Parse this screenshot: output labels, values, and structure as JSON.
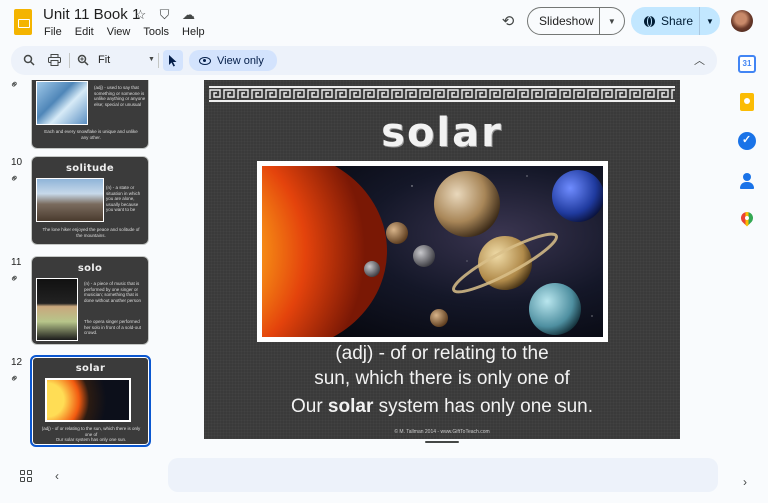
{
  "header": {
    "title": "Unit 11 Book 1",
    "menu": [
      "File",
      "Edit",
      "View",
      "Tools",
      "Help"
    ],
    "slideshow_label": "Slideshow",
    "share_label": "Share"
  },
  "toolbar": {
    "zoom": "Fit",
    "view_only_label": "View only"
  },
  "filmstrip": {
    "slides": [
      {
        "number": "",
        "title": "",
        "text": "(adj) - used to say that something or someone is unlike anything or anyone else; special or unusual",
        "caption": "Each and every snowflake is unique and unlike any other."
      },
      {
        "number": "10",
        "title": "solitude",
        "text": "(n) - a state or situation in which you are alone, usually because you want to be",
        "caption": "The lone hiker enjoyed the peace and solitude of the mountains."
      },
      {
        "number": "11",
        "title": "solo",
        "text": "(n) - a piece of music that is performed by one singer or musician; something that is done without another person",
        "caption": "The opera singer performed her solo in front of a sold-out crowd."
      },
      {
        "number": "12",
        "title": "solar",
        "text": "(adj) - of or relating to the sun, which there is only one of",
        "caption": "Our solar system has only one sun."
      }
    ]
  },
  "slide": {
    "title": "solar",
    "definition_line1": "(adj) - of or relating to the",
    "definition_line2": "sun, which there is only one of",
    "example_before": "Our ",
    "example_bold": "solar",
    "example_after": " system has only one sun.",
    "credit": "© M. Tallman 2014 - www.GiftToTeach.com"
  },
  "side_panel": {
    "icons": [
      "calendar-icon",
      "keep-icon",
      "tasks-icon",
      "contacts-icon",
      "maps-icon"
    ],
    "calendar_day": "31"
  },
  "colors": {
    "accent": "#0b57d0",
    "share_bg": "#c2e7ff",
    "toolbar_bg": "#edf2fa",
    "slide_bg": "#3a3a3a",
    "logo": "#f4b400"
  }
}
